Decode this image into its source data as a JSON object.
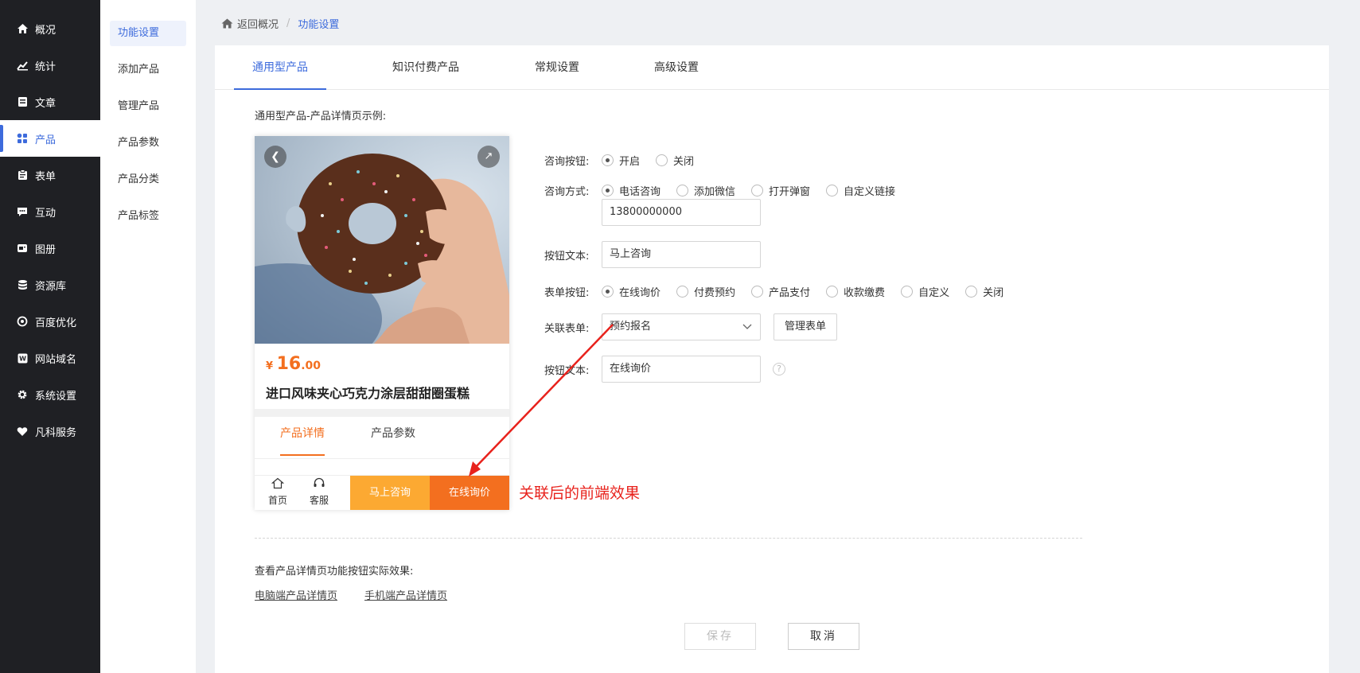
{
  "sidebar": {
    "items": [
      {
        "label": "概况",
        "icon": "home-icon"
      },
      {
        "label": "统计",
        "icon": "chart-icon"
      },
      {
        "label": "文章",
        "icon": "article-icon"
      },
      {
        "label": "产品",
        "icon": "grid-icon"
      },
      {
        "label": "表单",
        "icon": "form-icon"
      },
      {
        "label": "互动",
        "icon": "chat-icon"
      },
      {
        "label": "图册",
        "icon": "album-icon"
      },
      {
        "label": "资源库",
        "icon": "database-icon"
      },
      {
        "label": "百度优化",
        "icon": "seo-icon"
      },
      {
        "label": "网站域名",
        "icon": "domain-icon"
      },
      {
        "label": "系统设置",
        "icon": "gear-icon"
      },
      {
        "label": "凡科服务",
        "icon": "heart-icon"
      }
    ],
    "active": "产品"
  },
  "subnav": {
    "items": [
      "功能设置",
      "添加产品",
      "管理产品",
      "产品参数",
      "产品分类",
      "产品标签"
    ],
    "active": "功能设置"
  },
  "breadcrumb": {
    "back": "返回概况",
    "current": "功能设置"
  },
  "tabs": [
    "通用型产品",
    "知识付费产品",
    "常规设置",
    "高级设置"
  ],
  "demo": {
    "title": "通用型产品-产品详情页示例:",
    "price_symbol": "¥",
    "price_int": "16",
    "price_dec": ".00",
    "product_name": "进口风味夹心巧克力涂层甜甜圈蛋糕",
    "tab_detail": "产品详情",
    "tab_params": "产品参数",
    "bar_home": "首页",
    "bar_service": "客服",
    "btn_consult": "马上咨询",
    "btn_inquiry": "在线询价",
    "callout": "关联后的前端效果"
  },
  "form": {
    "consult_button_label": "咨询按钮:",
    "consult_button_options": [
      "开启",
      "关闭"
    ],
    "consult_method_label": "咨询方式:",
    "consult_method_options": [
      "电话咨询",
      "添加微信",
      "打开弹窗",
      "自定义链接"
    ],
    "phone_value": "13800000000",
    "button_text_label": "按钮文本:",
    "button_text_value": "马上咨询",
    "form_button_label": "表单按钮:",
    "form_button_options": [
      "在线询价",
      "付费预约",
      "产品支付",
      "收款缴费",
      "自定义",
      "关闭"
    ],
    "linked_form_label": "关联表单:",
    "linked_form_value": "预约报名",
    "manage_form_button": "管理表单",
    "button_text2_label": "按钮文本:",
    "button_text2_value": "在线询价",
    "help": "?"
  },
  "footer": {
    "title": "查看产品详情页功能按钮实际效果:",
    "link_pc": "电脑端产品详情页",
    "link_mobile": "手机端产品详情页",
    "save": "保存",
    "cancel": "取消"
  },
  "colors": {
    "accent": "#3d6bdc",
    "orange": "#f36f1f",
    "yellow": "#fca932",
    "annotation": "#e8221c",
    "sidebar": "#1f2024"
  }
}
